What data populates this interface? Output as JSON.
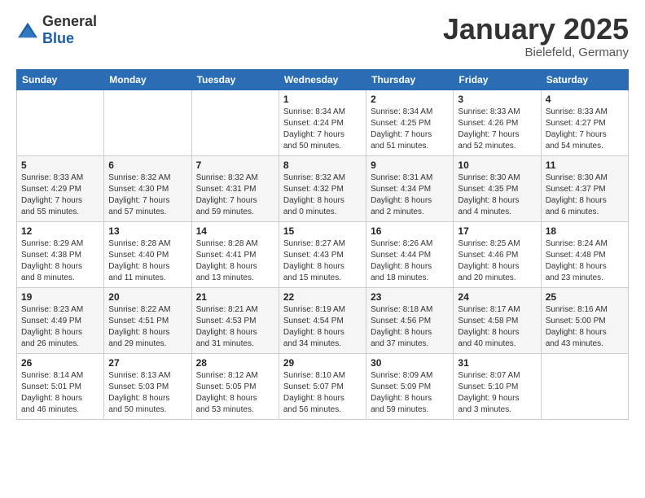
{
  "header": {
    "logo_general": "General",
    "logo_blue": "Blue",
    "month_title": "January 2025",
    "location": "Bielefeld, Germany"
  },
  "calendar": {
    "days_of_week": [
      "Sunday",
      "Monday",
      "Tuesday",
      "Wednesday",
      "Thursday",
      "Friday",
      "Saturday"
    ],
    "weeks": [
      [
        {
          "day": "",
          "content": ""
        },
        {
          "day": "",
          "content": ""
        },
        {
          "day": "",
          "content": ""
        },
        {
          "day": "1",
          "content": "Sunrise: 8:34 AM\nSunset: 4:24 PM\nDaylight: 7 hours\nand 50 minutes."
        },
        {
          "day": "2",
          "content": "Sunrise: 8:34 AM\nSunset: 4:25 PM\nDaylight: 7 hours\nand 51 minutes."
        },
        {
          "day": "3",
          "content": "Sunrise: 8:33 AM\nSunset: 4:26 PM\nDaylight: 7 hours\nand 52 minutes."
        },
        {
          "day": "4",
          "content": "Sunrise: 8:33 AM\nSunset: 4:27 PM\nDaylight: 7 hours\nand 54 minutes."
        }
      ],
      [
        {
          "day": "5",
          "content": "Sunrise: 8:33 AM\nSunset: 4:29 PM\nDaylight: 7 hours\nand 55 minutes."
        },
        {
          "day": "6",
          "content": "Sunrise: 8:32 AM\nSunset: 4:30 PM\nDaylight: 7 hours\nand 57 minutes."
        },
        {
          "day": "7",
          "content": "Sunrise: 8:32 AM\nSunset: 4:31 PM\nDaylight: 7 hours\nand 59 minutes."
        },
        {
          "day": "8",
          "content": "Sunrise: 8:32 AM\nSunset: 4:32 PM\nDaylight: 8 hours\nand 0 minutes."
        },
        {
          "day": "9",
          "content": "Sunrise: 8:31 AM\nSunset: 4:34 PM\nDaylight: 8 hours\nand 2 minutes."
        },
        {
          "day": "10",
          "content": "Sunrise: 8:30 AM\nSunset: 4:35 PM\nDaylight: 8 hours\nand 4 minutes."
        },
        {
          "day": "11",
          "content": "Sunrise: 8:30 AM\nSunset: 4:37 PM\nDaylight: 8 hours\nand 6 minutes."
        }
      ],
      [
        {
          "day": "12",
          "content": "Sunrise: 8:29 AM\nSunset: 4:38 PM\nDaylight: 8 hours\nand 8 minutes."
        },
        {
          "day": "13",
          "content": "Sunrise: 8:28 AM\nSunset: 4:40 PM\nDaylight: 8 hours\nand 11 minutes."
        },
        {
          "day": "14",
          "content": "Sunrise: 8:28 AM\nSunset: 4:41 PM\nDaylight: 8 hours\nand 13 minutes."
        },
        {
          "day": "15",
          "content": "Sunrise: 8:27 AM\nSunset: 4:43 PM\nDaylight: 8 hours\nand 15 minutes."
        },
        {
          "day": "16",
          "content": "Sunrise: 8:26 AM\nSunset: 4:44 PM\nDaylight: 8 hours\nand 18 minutes."
        },
        {
          "day": "17",
          "content": "Sunrise: 8:25 AM\nSunset: 4:46 PM\nDaylight: 8 hours\nand 20 minutes."
        },
        {
          "day": "18",
          "content": "Sunrise: 8:24 AM\nSunset: 4:48 PM\nDaylight: 8 hours\nand 23 minutes."
        }
      ],
      [
        {
          "day": "19",
          "content": "Sunrise: 8:23 AM\nSunset: 4:49 PM\nDaylight: 8 hours\nand 26 minutes."
        },
        {
          "day": "20",
          "content": "Sunrise: 8:22 AM\nSunset: 4:51 PM\nDaylight: 8 hours\nand 29 minutes."
        },
        {
          "day": "21",
          "content": "Sunrise: 8:21 AM\nSunset: 4:53 PM\nDaylight: 8 hours\nand 31 minutes."
        },
        {
          "day": "22",
          "content": "Sunrise: 8:19 AM\nSunset: 4:54 PM\nDaylight: 8 hours\nand 34 minutes."
        },
        {
          "day": "23",
          "content": "Sunrise: 8:18 AM\nSunset: 4:56 PM\nDaylight: 8 hours\nand 37 minutes."
        },
        {
          "day": "24",
          "content": "Sunrise: 8:17 AM\nSunset: 4:58 PM\nDaylight: 8 hours\nand 40 minutes."
        },
        {
          "day": "25",
          "content": "Sunrise: 8:16 AM\nSunset: 5:00 PM\nDaylight: 8 hours\nand 43 minutes."
        }
      ],
      [
        {
          "day": "26",
          "content": "Sunrise: 8:14 AM\nSunset: 5:01 PM\nDaylight: 8 hours\nand 46 minutes."
        },
        {
          "day": "27",
          "content": "Sunrise: 8:13 AM\nSunset: 5:03 PM\nDaylight: 8 hours\nand 50 minutes."
        },
        {
          "day": "28",
          "content": "Sunrise: 8:12 AM\nSunset: 5:05 PM\nDaylight: 8 hours\nand 53 minutes."
        },
        {
          "day": "29",
          "content": "Sunrise: 8:10 AM\nSunset: 5:07 PM\nDaylight: 8 hours\nand 56 minutes."
        },
        {
          "day": "30",
          "content": "Sunrise: 8:09 AM\nSunset: 5:09 PM\nDaylight: 8 hours\nand 59 minutes."
        },
        {
          "day": "31",
          "content": "Sunrise: 8:07 AM\nSunset: 5:10 PM\nDaylight: 9 hours\nand 3 minutes."
        },
        {
          "day": "",
          "content": ""
        }
      ]
    ]
  }
}
